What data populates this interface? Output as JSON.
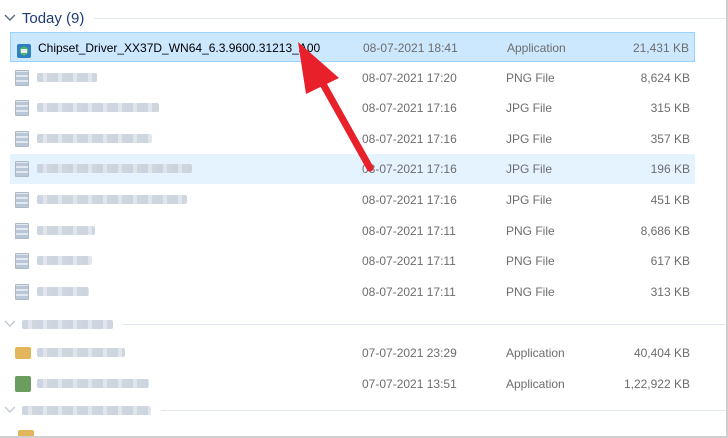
{
  "group_today": {
    "title": "Today (9)",
    "expanded": true
  },
  "group_collapsed_labels_obscured": true,
  "files": [
    {
      "name": "Chipset_Driver_XX37D_WN64_6.3.9600.31213_A00",
      "date": "08-07-2021 18:41",
      "type": "Application",
      "size": "21,431 KB",
      "icon": "installer-icon",
      "selected": true,
      "name_obscured": false
    },
    {
      "name": "",
      "date": "08-07-2021 17:20",
      "type": "PNG File",
      "size": "8,624 KB",
      "icon": "image-file-icon",
      "name_obscured": true
    },
    {
      "name": "",
      "date": "08-07-2021 17:16",
      "type": "JPG File",
      "size": "315 KB",
      "icon": "image-file-icon",
      "name_obscured": true
    },
    {
      "name": "",
      "date": "08-07-2021 17:16",
      "type": "JPG File",
      "size": "357 KB",
      "icon": "image-file-icon",
      "name_obscured": true
    },
    {
      "name": "",
      "date": "08-07-2021 17:16",
      "type": "JPG File",
      "size": "196 KB",
      "icon": "image-file-icon",
      "name_obscured": true,
      "hover": true
    },
    {
      "name": "",
      "date": "08-07-2021 17:16",
      "type": "JPG File",
      "size": "451 KB",
      "icon": "image-file-icon",
      "name_obscured": true
    },
    {
      "name": "",
      "date": "08-07-2021 17:11",
      "type": "PNG File",
      "size": "8,686 KB",
      "icon": "image-file-icon",
      "name_obscured": true
    },
    {
      "name": "",
      "date": "08-07-2021 17:11",
      "type": "PNG File",
      "size": "617 KB",
      "icon": "image-file-icon",
      "name_obscured": true
    },
    {
      "name": "",
      "date": "08-07-2021 17:11",
      "type": "PNG File",
      "size": "313 KB",
      "icon": "image-file-icon",
      "name_obscured": true
    }
  ],
  "files_group2": [
    {
      "name": "",
      "date": "07-07-2021 23:29",
      "type": "Application",
      "size": "40,404 KB",
      "icon": "folder-app-icon",
      "name_obscured": true
    },
    {
      "name": "",
      "date": "07-07-2021 13:51",
      "type": "Application",
      "size": "1,22,922 KB",
      "icon": "setup-app-icon",
      "name_obscured": true
    }
  ],
  "colors": {
    "selection": "#cce8ff",
    "selection_border": "#99d1ff",
    "hover": "#e5f3ff",
    "group_title": "#1e3c78",
    "annotation_arrow": "#e8202a"
  }
}
